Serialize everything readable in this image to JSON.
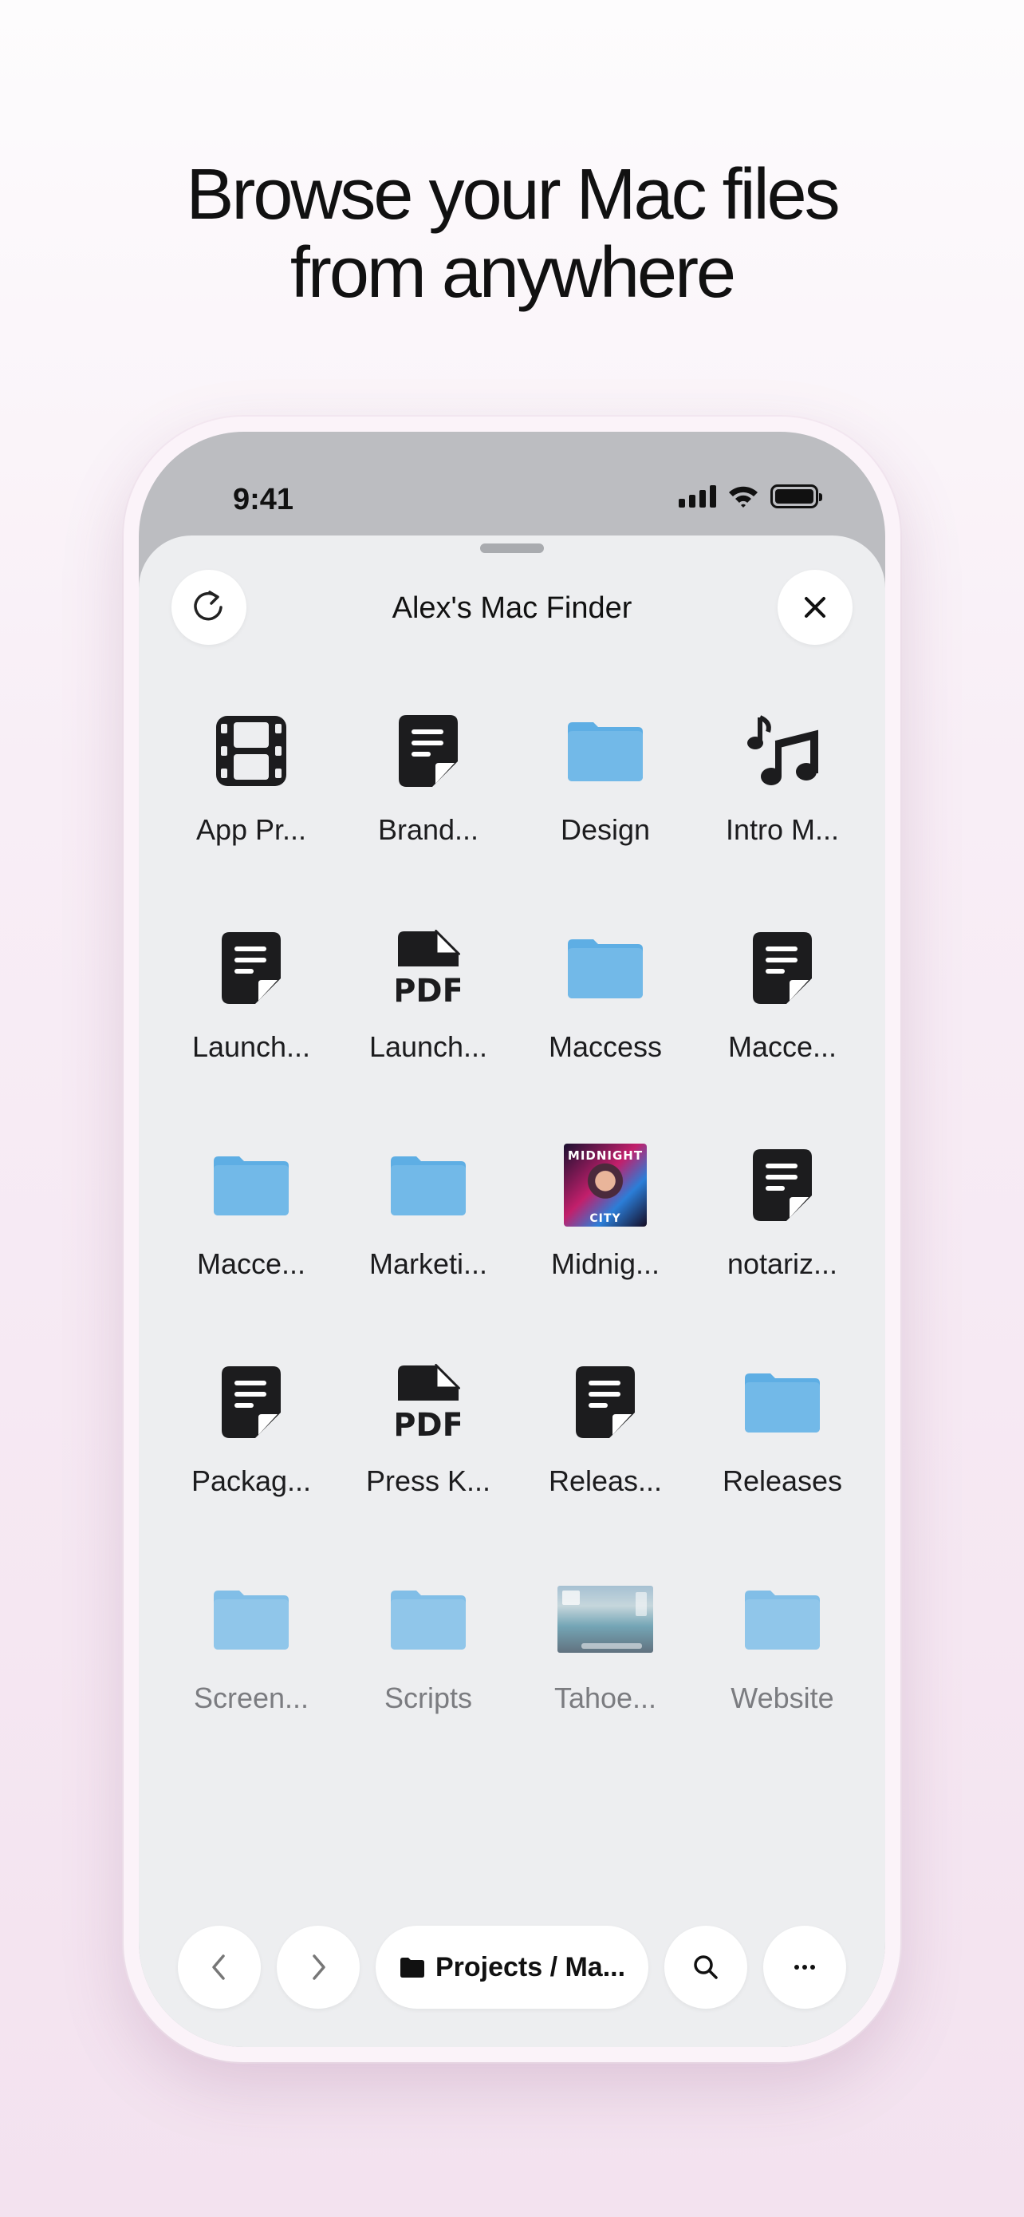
{
  "headline": {
    "line1": "Browse your Mac files",
    "line2": "from anywhere"
  },
  "status_bar": {
    "time": "9:41",
    "icons": [
      "cellular-signal-icon",
      "wifi-icon",
      "battery-icon"
    ]
  },
  "sheet": {
    "title": "Alex's Mac Finder",
    "refresh_icon": "refresh-icon",
    "close_icon": "close-icon"
  },
  "files": [
    {
      "label": "App Pr...",
      "kind": "video",
      "icon": "film-icon"
    },
    {
      "label": "Brand...",
      "kind": "document",
      "icon": "document-icon"
    },
    {
      "label": "Design",
      "kind": "folder",
      "icon": "folder-icon"
    },
    {
      "label": "Intro M...",
      "kind": "audio",
      "icon": "music-icon"
    },
    {
      "label": "Launch...",
      "kind": "document",
      "icon": "document-icon"
    },
    {
      "label": "Launch...",
      "kind": "pdf",
      "icon": "pdf-icon",
      "badge": "PDF"
    },
    {
      "label": "Maccess",
      "kind": "folder",
      "icon": "folder-icon"
    },
    {
      "label": "Macce...",
      "kind": "document",
      "icon": "document-icon"
    },
    {
      "label": "Macce...",
      "kind": "folder",
      "icon": "folder-icon"
    },
    {
      "label": "Marketi...",
      "kind": "folder",
      "icon": "folder-icon"
    },
    {
      "label": "Midnig...",
      "kind": "image",
      "icon": "midnight-city-thumbnail",
      "thumb_text_top": "MIDNIGHT",
      "thumb_text_bottom": "CITY"
    },
    {
      "label": "notariz...",
      "kind": "document",
      "icon": "document-icon"
    },
    {
      "label": "Packag...",
      "kind": "document",
      "icon": "document-icon"
    },
    {
      "label": "Press K...",
      "kind": "pdf",
      "icon": "pdf-icon",
      "badge": "PDF"
    },
    {
      "label": "Releas...",
      "kind": "document",
      "icon": "document-icon"
    },
    {
      "label": "Releases",
      "kind": "folder",
      "icon": "folder-icon"
    },
    {
      "label": "Screen...",
      "kind": "folder",
      "icon": "folder-icon",
      "faded": true
    },
    {
      "label": "Scripts",
      "kind": "folder",
      "icon": "folder-icon",
      "faded": true
    },
    {
      "label": "Tahoe...",
      "kind": "image",
      "icon": "tahoe-screenshot-thumbnail",
      "faded": true
    },
    {
      "label": "Website",
      "kind": "folder",
      "icon": "folder-icon",
      "faded": true
    }
  ],
  "toolbar": {
    "back_icon": "chevron-left-icon",
    "forward_icon": "chevron-right-icon",
    "path_label": "Projects / Ma...",
    "path_icon": "folder-fill-icon",
    "search_icon": "search-icon",
    "more_icon": "ellipsis-icon"
  },
  "colors": {
    "folder": "#72b9e8",
    "sheet": "#edeef0",
    "status_area": "#bcbdc1"
  }
}
